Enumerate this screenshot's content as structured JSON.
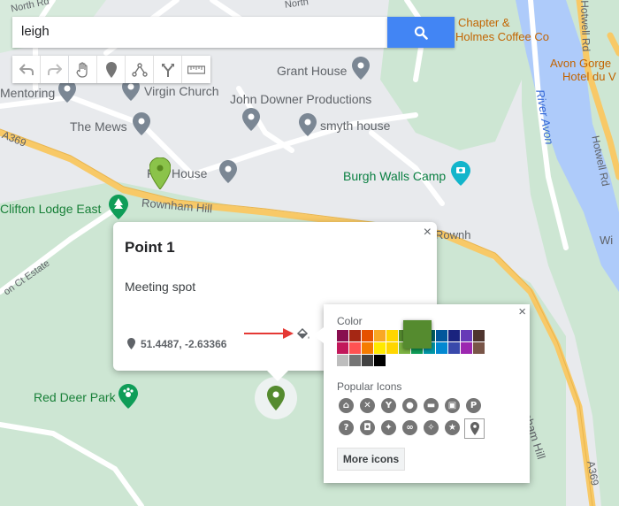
{
  "search": {
    "value": "leigh"
  },
  "toolbar": {
    "undo_icon": "undo-icon",
    "redo_icon": "redo-icon",
    "hand_icon": "hand-icon",
    "marker_icon": "marker-icon",
    "line_icon": "draw-line-icon",
    "directions_icon": "directions-icon",
    "ruler_icon": "ruler-icon"
  },
  "map": {
    "labels": {
      "north_rd_1": "North Rd",
      "north_rd_2": "North",
      "chapter": "Chapter &",
      "holmes": "Holmes Coffee Co",
      "grant_house": "Grant House",
      "mentoring": "Mentoring",
      "virgin_church": "Virgin Church",
      "john_downer": "John Downer Productions",
      "the_mews": "The Mews",
      "smyth_house": "smyth house",
      "fire_house": "Fire House",
      "burgh_walls": "Burgh Walls Camp",
      "clifton_lodge": "Clifton Lodge East",
      "rownham_hill": "Rownham Hill",
      "rownham_hill_2": "Rownham Hill",
      "rownham_hill_3": "Rownham Hill",
      "a369_1": "A369",
      "a369_2": "A369",
      "avon_gorge": "Avon Gorge",
      "hotel_du": "Hotel du V",
      "river_avon": "River Avon",
      "hotwell_rd_1": "Hotwell Rd",
      "hotwell_rd_2": "Hotwell Rd",
      "wi": "Wi",
      "ct_estate": "on Ct Estate",
      "red_deer_park": "Red Deer Park"
    }
  },
  "card": {
    "title": "Point 1",
    "description": "Meeting spot",
    "coordinates": "51.4487, -2.63366",
    "close": "×"
  },
  "palette": {
    "close": "×",
    "color_label": "Color",
    "selected_color": "#558b2f",
    "colors_row1": [
      "#880e4f",
      "#a52714",
      "#e65100",
      "#f9a825",
      "#ffd600",
      "#558b2f",
      "#097138",
      "#006064",
      "#01579b",
      "#1a237e",
      "#673ab7",
      "#4e342e"
    ],
    "colors_row2": [
      "#c2185b",
      "#ff5252",
      "#f57c00",
      "#ffea00",
      "#ffd600",
      "#7cb342",
      "#0f9d58",
      "#0097a7",
      "#0288d1",
      "#3949ab",
      "#9c27b0",
      "#795548"
    ],
    "colors_row3": [
      "#bdbdbd",
      "#757575",
      "#424242",
      "#000000"
    ],
    "icons_label": "Popular Icons",
    "icons_row1": [
      "home-icon",
      "restaurant-icon",
      "bar-icon",
      "pet-icon",
      "hotel-icon",
      "shopping-icon",
      "parking-icon"
    ],
    "icons_row2": [
      "help-icon",
      "camera-icon",
      "walking-icon",
      "cycling-icon",
      "running-icon",
      "star-icon",
      "pin-icon"
    ],
    "more_icons": "More icons"
  }
}
